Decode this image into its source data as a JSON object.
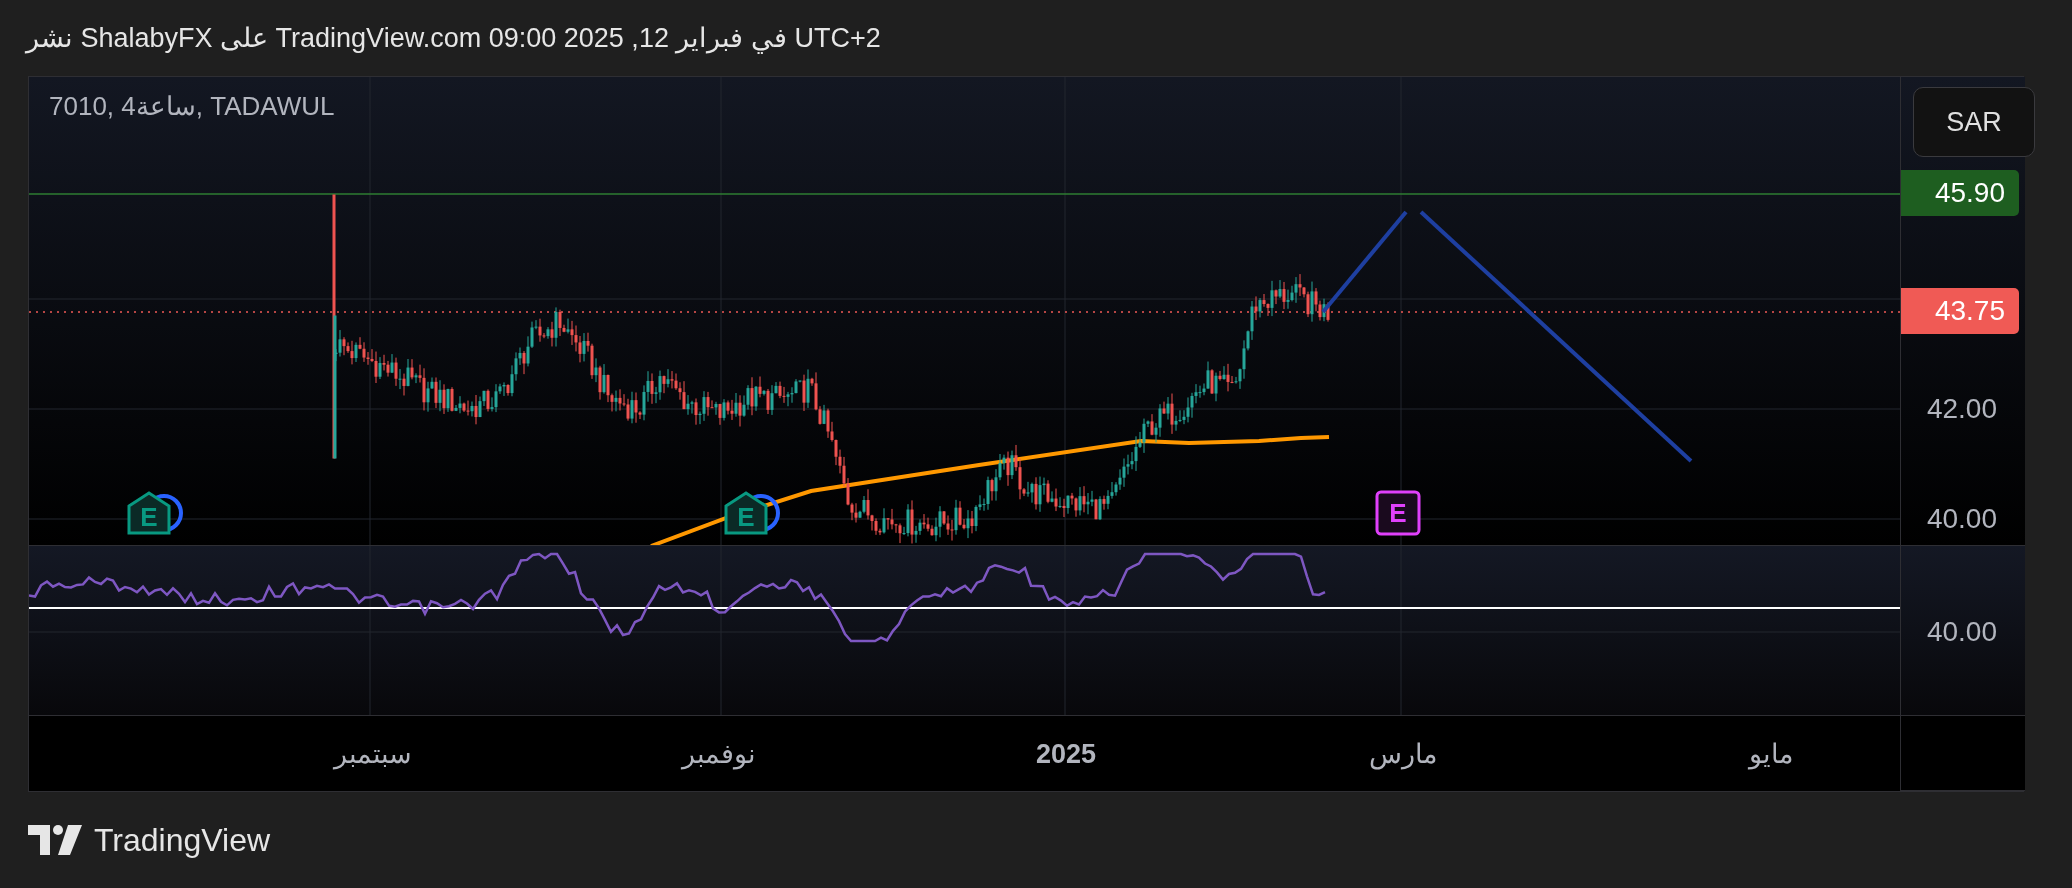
{
  "header": {
    "text": "نشر ShalabyFX على TradingView.com في فبراير 12, 2025 09:00 UTC+2"
  },
  "chart": {
    "symbol": "7010, 4ساعة, TADAWUL",
    "currency": "SAR",
    "price_labels": [
      {
        "kind": "level",
        "text": "45.90"
      },
      {
        "kind": "last",
        "text": "43.75"
      }
    ],
    "price_ticks": [
      "42.00",
      "40.00"
    ],
    "events": [
      {
        "kind": "upcoming",
        "label": "E"
      },
      {
        "kind": "past",
        "label": "E"
      },
      {
        "kind": "past",
        "label": "E"
      }
    ],
    "rsi_ticks": [
      "40.00"
    ],
    "time_labels": [
      {
        "kind": "month",
        "text": "مايو"
      },
      {
        "kind": "month",
        "text": "مارس"
      },
      {
        "kind": "year",
        "text": "2025"
      },
      {
        "kind": "month",
        "text": "نوفمبر"
      },
      {
        "kind": "month",
        "text": "سبتمبر"
      }
    ]
  },
  "footer": {
    "brand": "TradingView"
  }
}
